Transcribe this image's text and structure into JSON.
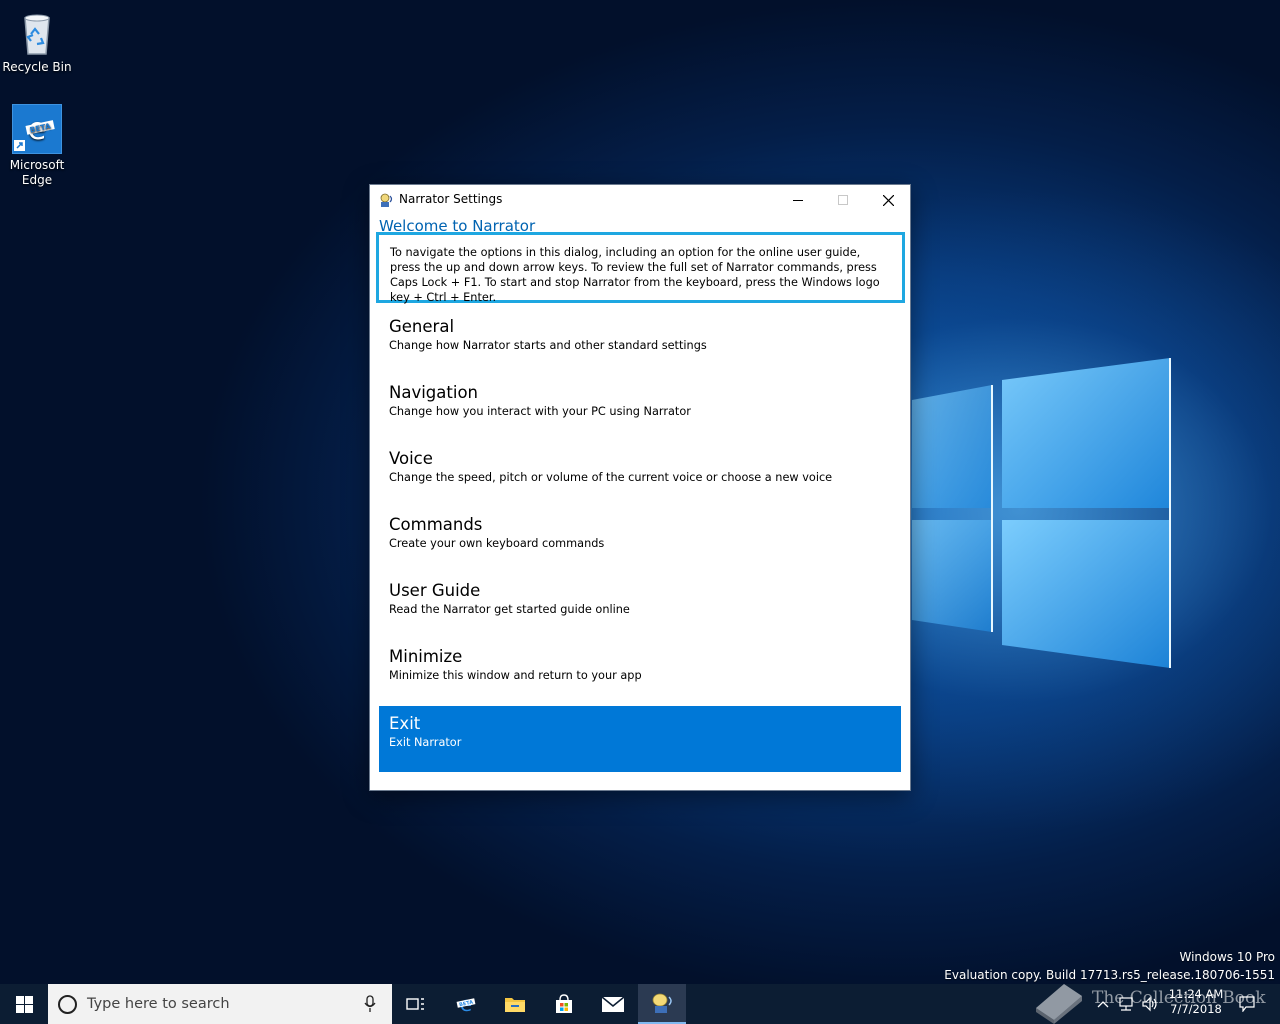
{
  "desktop": {
    "icons": [
      {
        "label": "Recycle Bin"
      },
      {
        "label": "Microsoft Edge",
        "badge": "BETA"
      }
    ],
    "watermark": {
      "edition": "Windows 10 Pro",
      "build": "Evaluation copy. Build 17713.rs5_release.180706-1551"
    }
  },
  "window": {
    "title": "Narrator Settings",
    "welcome": "Welcome to Narrator",
    "intro": "To navigate the options in this dialog, including an option for the online user guide, press the up and down arrow keys. To review the full set of Narrator commands, press Caps Lock + F1. To start and stop Narrator from the keyboard, press the Windows logo key + Ctrl + Enter.",
    "items": [
      {
        "title": "General",
        "desc": "Change how Narrator starts and other standard settings"
      },
      {
        "title": "Navigation",
        "desc": "Change how you interact with your PC using Narrator"
      },
      {
        "title": "Voice",
        "desc": "Change the speed, pitch or volume of the current voice or choose a new voice"
      },
      {
        "title": "Commands",
        "desc": "Create your own keyboard commands"
      },
      {
        "title": "User Guide",
        "desc": "Read the Narrator get started guide online"
      },
      {
        "title": "Minimize",
        "desc": "Minimize this window and return to your app"
      },
      {
        "title": "Exit",
        "desc": "Exit Narrator"
      }
    ],
    "selected_item": "Exit",
    "controls": {
      "minimize": "minimize",
      "maximize": "maximize",
      "close": "close"
    }
  },
  "taskbar": {
    "search_placeholder": "Type here to search",
    "pinned": [
      "start-icon",
      "task-view-icon",
      "edge-icon",
      "file-explorer-icon",
      "store-icon",
      "mail-icon",
      "narrator-icon"
    ],
    "clock": {
      "time": "11:24 AM",
      "date": "7/7/2018"
    }
  },
  "overlay": {
    "brand": "The Collection Book"
  },
  "colors": {
    "accent": "#0078d7",
    "focus_border": "#1ea7e1",
    "link_blue": "#0063b1",
    "taskbar": "#0c1d33"
  }
}
